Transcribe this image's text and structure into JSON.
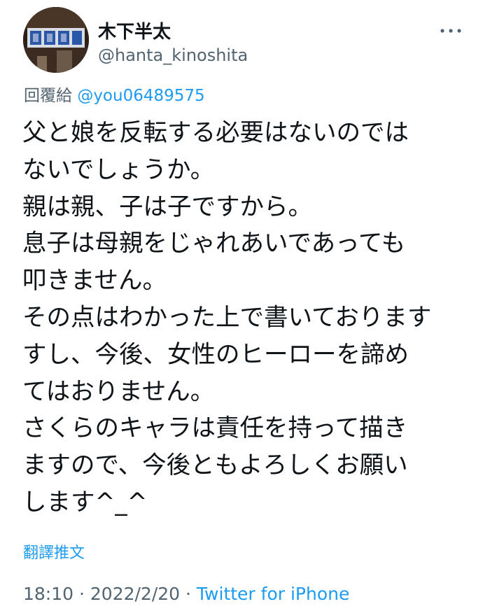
{
  "author": {
    "display_name": "木下半太",
    "handle": "@hanta_kinoshita"
  },
  "more_icon": "more-dots-icon",
  "reply": {
    "prefix": "回覆給",
    "mention": "@you06489575"
  },
  "tweet": {
    "lines": [
      "父と娘を反転する必要はないのでは",
      "ないでしょうか。",
      "親は親、子は子ですから。",
      "息子は母親をじゃれあいであっても",
      "叩きません。",
      "その点はわかった上で書いております",
      "すし、今後、女性のヒーローを諦め",
      "てはおりません。",
      "さくらのキャラは責任を持って描き",
      "ますので、今後ともよろしくお願い",
      "します^_^"
    ]
  },
  "translate_label": "翻譯推文",
  "meta": {
    "time": "18:10",
    "separator": " · ",
    "date": "2022/2/20",
    "source": "Twitter for iPhone"
  },
  "colors": {
    "text": "#0f1419",
    "secondary": "#536471",
    "accent": "#1d9bf0"
  }
}
